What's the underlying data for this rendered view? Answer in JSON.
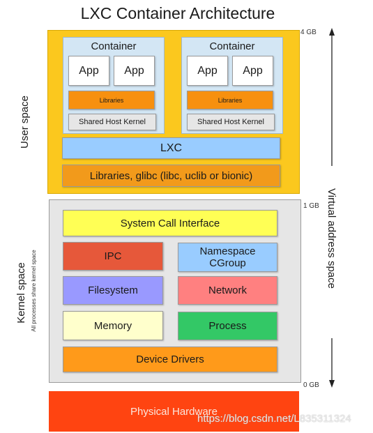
{
  "title": "LXC Container Architecture",
  "user_space": {
    "label": "User space",
    "containers": [
      {
        "label": "Container",
        "apps": [
          "App",
          "App"
        ],
        "libraries": "Libraries",
        "kernel": "Shared Host Kernel"
      },
      {
        "label": "Container",
        "apps": [
          "App",
          "App"
        ],
        "libraries": "Libraries",
        "kernel": "Shared Host Kernel"
      }
    ],
    "lxc": "LXC",
    "libraries": "Libraries, glibc (libc, uclib or bionic)"
  },
  "kernel_space": {
    "label": "Kernel space",
    "sublabel": "All processes share kernel space",
    "syscall": "System Call Interface",
    "ipc": "IPC",
    "namespace": "Namespace",
    "cgroup": "CGroup",
    "filesystem": "Filesystem",
    "network": "Network",
    "memory": "Memory",
    "process": "Process",
    "drivers": "Device Drivers"
  },
  "hardware": "Physical Hardware",
  "address": {
    "label": "Virtual address space",
    "top": "4 GB",
    "mid": "1 GB",
    "bottom": "0 GB"
  },
  "watermark": "https://blog.csdn.net/L835311324",
  "colors": {
    "user": "#fbc81e",
    "container": "#d3e6f4",
    "lxc": "#99ccff",
    "orange": "#f7900f",
    "kernel": "#e6e6e6",
    "syscall": "#ffff55",
    "ipc": "#e6583a",
    "filesystem": "#9999ff",
    "network": "#ff8080",
    "memory": "#ffffcc",
    "process": "#33c866",
    "hardware": "#ff4411"
  }
}
